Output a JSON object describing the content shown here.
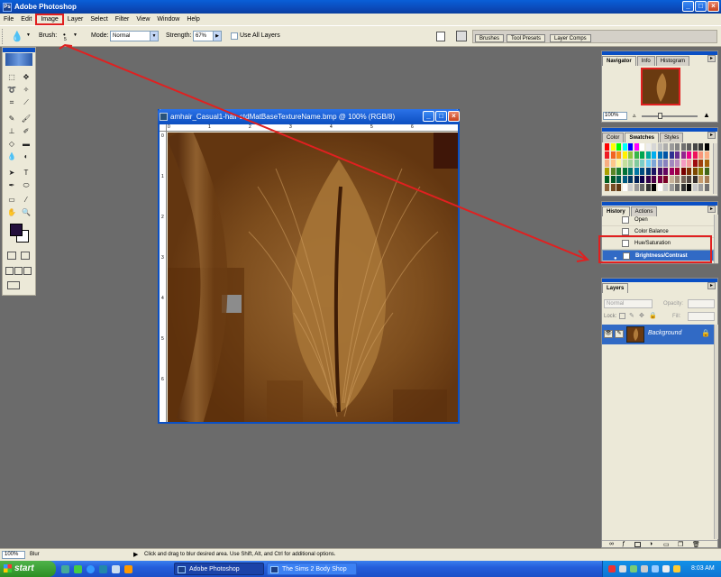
{
  "app": {
    "title": "Adobe Photoshop"
  },
  "menu": [
    "File",
    "Edit",
    "Image",
    "Layer",
    "Select",
    "Filter",
    "View",
    "Window",
    "Help"
  ],
  "options": {
    "brush_label": "Brush:",
    "brush_size": "5",
    "mode_label": "Mode:",
    "mode_value": "Normal",
    "strength_label": "Strength:",
    "strength_value": "67%",
    "use_all_layers": "Use All Layers",
    "well_tabs": [
      "Brushes",
      "Tool Presets",
      "Layer Comps"
    ]
  },
  "document": {
    "title": "amhair_Casual1-hair-stdMatBaseTextureName.bmp @ 100% (RGB/8)",
    "ruler_h": [
      "0",
      "1",
      "2",
      "3",
      "4",
      "5",
      "6"
    ],
    "ruler_v": [
      "0",
      "1",
      "2",
      "3",
      "4",
      "5",
      "6"
    ]
  },
  "navigator": {
    "tabs": [
      "Navigator",
      "Info",
      "Histogram"
    ],
    "zoom": "100%"
  },
  "color_palette": {
    "tabs": [
      "Color",
      "Swatches",
      "Styles"
    ],
    "swatch_rows": [
      [
        "#ff0000",
        "#ffff00",
        "#00ff00",
        "#00ffff",
        "#0000ff",
        "#ff00ff",
        "#ffffff",
        "#ebebeb",
        "#d6d6d6",
        "#c2c2c2",
        "#adadad",
        "#999999",
        "#858585",
        "#707070",
        "#5c5c5c",
        "#474747",
        "#333333",
        "#000000"
      ],
      [
        "#ee1d24",
        "#f26522",
        "#f7941d",
        "#fff200",
        "#8dc63f",
        "#39b54a",
        "#00a651",
        "#00a99d",
        "#00aeef",
        "#0072bc",
        "#0054a6",
        "#2e3192",
        "#662d91",
        "#92278f",
        "#ec008c",
        "#ed145b",
        "#f7977a",
        "#fbad82"
      ],
      [
        "#f9ad81",
        "#fdc68a",
        "#fff79a",
        "#c4df9b",
        "#a3d39c",
        "#82ca9d",
        "#7bcdc8",
        "#6ecff6",
        "#7ea7d8",
        "#8493ca",
        "#8882be",
        "#a187be",
        "#bc8dbf",
        "#f49ac2",
        "#f6989d",
        "#9e0b0f",
        "#a0410d",
        "#a36209"
      ],
      [
        "#aba000",
        "#598527",
        "#1a7b30",
        "#007236",
        "#00746b",
        "#0076a3",
        "#004b80",
        "#003471",
        "#1b1464",
        "#440e62",
        "#630460",
        "#9e005d",
        "#9e0039",
        "#790000",
        "#7b2e00",
        "#7d4900",
        "#827b00",
        "#406618"
      ],
      [
        "#005e20",
        "#005826",
        "#005952",
        "#005b7f",
        "#003663",
        "#002157",
        "#0d004c",
        "#32004b",
        "#4b0049",
        "#7b0046",
        "#7a0026",
        "#c7b299",
        "#998675",
        "#736357",
        "#534741",
        "#37302d",
        "#c69c6d",
        "#a67c52"
      ],
      [
        "#8c6239",
        "#754c24",
        "#603913",
        "#ffffff",
        "#cccccc",
        "#999999",
        "#666666",
        "#333333",
        "#000000",
        "#ffffff",
        "#cccccc",
        "#999999",
        "#666666",
        "#333333",
        "#000000",
        "#c8c8c8",
        "#9e9e9e",
        "#707070"
      ]
    ]
  },
  "history": {
    "tabs": [
      "History",
      "Actions"
    ],
    "items": [
      "Open",
      "Color Balance",
      "Hue/Saturation",
      "Brightness/Contrast"
    ],
    "selected_index": 3
  },
  "layers": {
    "tab": "Layers",
    "blend_mode": "Normal",
    "opacity_label": "Opacity:",
    "lock_label": "Lock:",
    "fill_label": "Fill:",
    "layer_name": "Background"
  },
  "status": {
    "zoom": "100%",
    "tool": "Blur",
    "hint": "Click and drag to blur desired area.  Use Shift, Alt, and Ctrl for additional options."
  },
  "taskbar": {
    "start": "start",
    "tasks": [
      "Adobe Photoshop",
      "The Sims 2 Body Shop"
    ],
    "clock": "8:03 AM"
  },
  "colors": {
    "annotation": "#e02020",
    "selection": "#316ac5",
    "foreground": "#24103c",
    "background": "#ffffff"
  }
}
